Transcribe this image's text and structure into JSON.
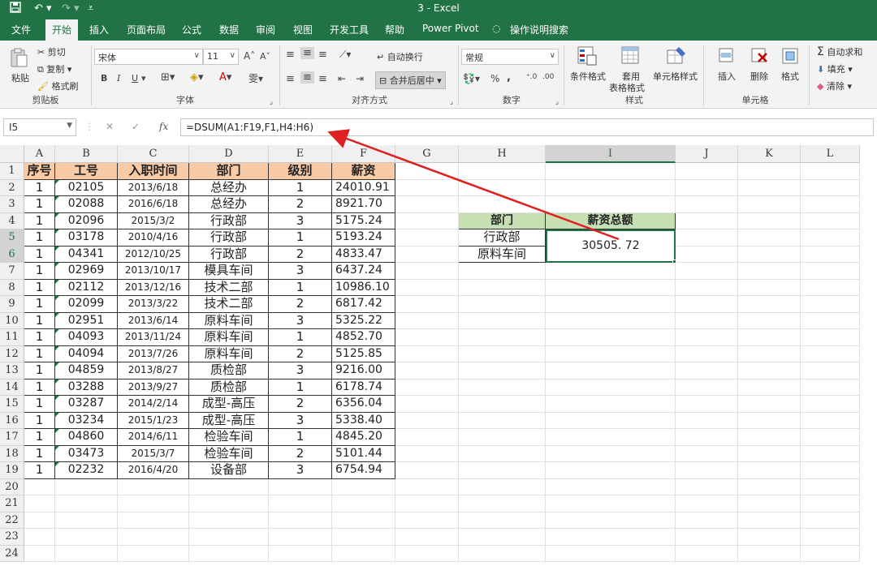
{
  "titlebar": {
    "title": "3  -  Excel"
  },
  "tabs": [
    "文件",
    "开始",
    "插入",
    "页面布局",
    "公式",
    "数据",
    "审阅",
    "视图",
    "开发工具",
    "帮助",
    "Power Pivot",
    "操作说明搜索"
  ],
  "ribbon": {
    "clipboard": {
      "paste": "粘贴",
      "cut": "剪切",
      "copy": "复制",
      "format_painter": "格式刷",
      "label": "剪贴板"
    },
    "font": {
      "name": "宋体",
      "size": "11",
      "label": "字体",
      "bold": "B",
      "italic": "I",
      "underline": "U"
    },
    "align": {
      "wrap": "自动换行",
      "merge": "合并后居中",
      "label": "对齐方式"
    },
    "number": {
      "format": "常规",
      "label": "数字",
      "percent": "%",
      "comma": ","
    },
    "styles": {
      "cond": "条件格式",
      "table1": "套用",
      "table2": "表格格式",
      "cell": "单元格样式",
      "label": "样式"
    },
    "cells": {
      "insert": "插入",
      "delete": "删除",
      "format": "格式",
      "label": "单元格"
    },
    "editing": {
      "autosum": "自动求和",
      "fill": "填充",
      "clear": "清除"
    }
  },
  "namebox": "I5",
  "formula": "=DSUM(A1:F19,F1,H4:H6)",
  "columns": [
    "A",
    "B",
    "C",
    "D",
    "E",
    "F",
    "G",
    "H",
    "I",
    "J",
    "K",
    "L"
  ],
  "rows": [
    "1",
    "2",
    "3",
    "4",
    "5",
    "6",
    "7",
    "8",
    "9",
    "10",
    "11",
    "12",
    "13",
    "14",
    "15",
    "16",
    "17",
    "18",
    "19",
    "20",
    "21",
    "22",
    "23",
    "24"
  ],
  "table": {
    "headers": [
      "序号",
      "工号",
      "入职时间",
      "部门",
      "级别",
      "薪资"
    ],
    "rows": [
      [
        "1",
        "02105",
        "2013/6/18",
        "总经办",
        "1",
        "24010.91"
      ],
      [
        "1",
        "02088",
        "2016/6/18",
        "总经办",
        "2",
        "8921.70"
      ],
      [
        "1",
        "02096",
        "2015/3/2",
        "行政部",
        "3",
        "5175.24"
      ],
      [
        "1",
        "03178",
        "2010/4/16",
        "行政部",
        "1",
        "5193.24"
      ],
      [
        "1",
        "04341",
        "2012/10/25",
        "行政部",
        "2",
        "4833.47"
      ],
      [
        "1",
        "02969",
        "2013/10/17",
        "模具车间",
        "3",
        "6437.24"
      ],
      [
        "1",
        "02112",
        "2013/12/16",
        "技术二部",
        "1",
        "10986.10"
      ],
      [
        "1",
        "02099",
        "2013/3/22",
        "技术二部",
        "2",
        "6817.42"
      ],
      [
        "1",
        "02951",
        "2013/6/14",
        "原料车间",
        "3",
        "5325.22"
      ],
      [
        "1",
        "04093",
        "2013/11/24",
        "原料车间",
        "1",
        "4852.70"
      ],
      [
        "1",
        "04094",
        "2013/7/26",
        "原料车间",
        "2",
        "5125.85"
      ],
      [
        "1",
        "04859",
        "2013/8/27",
        "质检部",
        "3",
        "9216.00"
      ],
      [
        "1",
        "03288",
        "2013/9/27",
        "质检部",
        "1",
        "6178.74"
      ],
      [
        "1",
        "03287",
        "2014/2/14",
        "成型-高压",
        "2",
        "6356.04"
      ],
      [
        "1",
        "03234",
        "2015/1/23",
        "成型-高压",
        "3",
        "5338.40"
      ],
      [
        "1",
        "04860",
        "2014/6/11",
        "检验车间",
        "1",
        "4845.20"
      ],
      [
        "1",
        "03473",
        "2015/3/7",
        "检验车间",
        "2",
        "5101.44"
      ],
      [
        "1",
        "02232",
        "2016/4/20",
        "设备部",
        "3",
        "6754.94"
      ]
    ]
  },
  "criteria": {
    "headers": [
      "部门",
      "薪资总额"
    ],
    "values": [
      "行政部",
      "原料车间"
    ],
    "result": "30505. 72"
  },
  "colors": {
    "excel_green": "#217346",
    "header_orange": "#f8cba6",
    "header_green": "#c6e0b4",
    "arrow_red": "#e02020"
  }
}
